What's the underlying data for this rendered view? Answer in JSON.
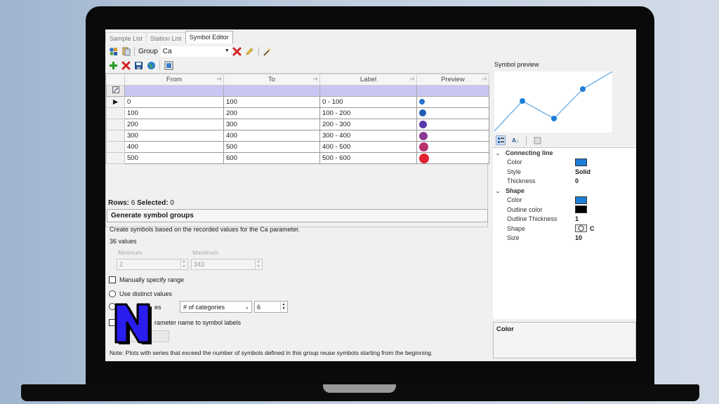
{
  "tabs": [
    "Sample List",
    "Station List",
    "Symbol Editor"
  ],
  "toolbar": {
    "group_label": "Group",
    "group_value": "Ca"
  },
  "grid": {
    "columns": [
      "From",
      "To",
      "Label",
      "Preview"
    ],
    "rows": [
      {
        "from": "0",
        "to": "100",
        "label": "0 - 100",
        "color": "#2a73c9",
        "size": 8
      },
      {
        "from": "100",
        "to": "200",
        "label": "100 - 200",
        "color": "#1f5fb4",
        "size": 10
      },
      {
        "from": "200",
        "to": "300",
        "label": "200 - 300",
        "color": "#5a3aa6",
        "size": 11
      },
      {
        "from": "300",
        "to": "400",
        "label": "300 - 400",
        "color": "#8a3a96",
        "size": 12
      },
      {
        "from": "400",
        "to": "500",
        "label": "400 - 500",
        "color": "#b4326e",
        "size": 13
      },
      {
        "from": "500",
        "to": "600",
        "label": "500 - 600",
        "color": "#e0232e",
        "size": 14
      }
    ]
  },
  "status": {
    "rows_label": "Rows:",
    "rows": "6",
    "selected_label": "Selected:",
    "selected": "0"
  },
  "generate": {
    "header": "Generate symbol groups",
    "text": "Create symbols based on the recorded values for the Ca parameter.",
    "count": "36 values",
    "min_label": "Minimum",
    "max_label": "Maximum",
    "min_value": "2",
    "max_value": "343",
    "manual_range": "Manually specify range",
    "distinct": "Use distinct values",
    "ranges_tail": "es",
    "categories_select": "# of categories",
    "categories_value": "6",
    "append_tail": "rameter name to symbol labels",
    "note": "Note: Plots with series that exceed the number of symbols defined in this group reuse symbols starting from the beginning."
  },
  "right": {
    "preview_title": "Symbol preview",
    "connecting_line": "Connecting line",
    "line_color_label": "Color",
    "line_color": "#1c7ed6",
    "style_label": "Style",
    "style_value": "Solid",
    "thickness_label": "Thickness",
    "thickness_value": "0",
    "shape": "Shape",
    "shape_color_label": "Color",
    "shape_color": "#1c7ed6",
    "outline_color_label": "Outline color",
    "outline_color": "#000000",
    "outline_thickness_label": "Outline Thickness",
    "outline_thickness_value": "1",
    "shape_label": "Shape",
    "shape_value": "C",
    "size_label": "Size",
    "size_value": "10",
    "description_title": "Color"
  }
}
